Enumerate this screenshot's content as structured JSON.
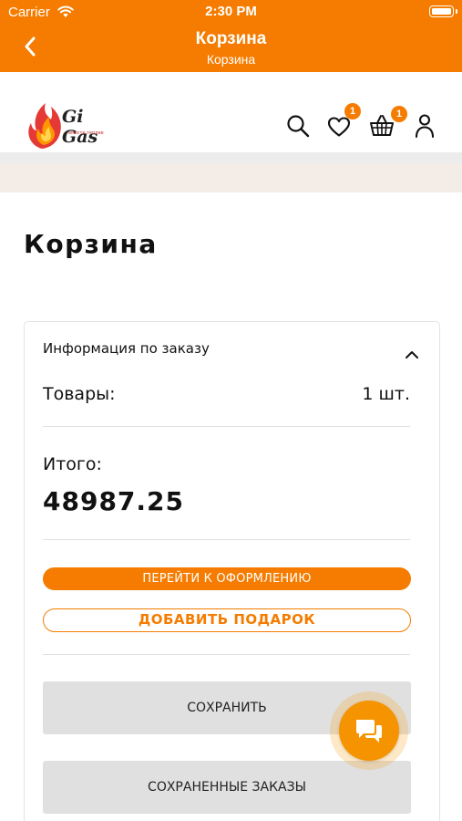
{
  "status_bar": {
    "carrier": "Carrier",
    "time": "2:30 PM"
  },
  "nav": {
    "title": "Корзина",
    "subtitle": "Корзина"
  },
  "header": {
    "logo_text": "Gi Gas",
    "logo_tagline": "вместе теплее",
    "favorites_count": "1",
    "cart_count": "1"
  },
  "page": {
    "title": "Корзина"
  },
  "order_info": {
    "heading": "Информация по заказу",
    "items_label": "Товары:",
    "items_value": "1 шт.",
    "total_label": "Итого:",
    "total_value": "48987.25",
    "checkout_label": "ПЕРЕЙТИ К ОФОРМЛЕНИЮ",
    "add_gift_label": "ДОБАВИТЬ ПОДАРОК",
    "save_label": "СОХРАНИТЬ",
    "saved_orders_label": "СОХРАНЕННЫЕ ЗАКАЗЫ"
  },
  "colors": {
    "accent": "#f57c00",
    "chat": "#f59400",
    "button_gray": "#e0e0e0"
  },
  "icons": [
    "back-arrow-icon",
    "wifi-icon",
    "battery-icon",
    "flame-logo",
    "search-icon",
    "heart-icon",
    "basket-icon",
    "user-icon",
    "chevron-up-icon",
    "chat-icon"
  ]
}
